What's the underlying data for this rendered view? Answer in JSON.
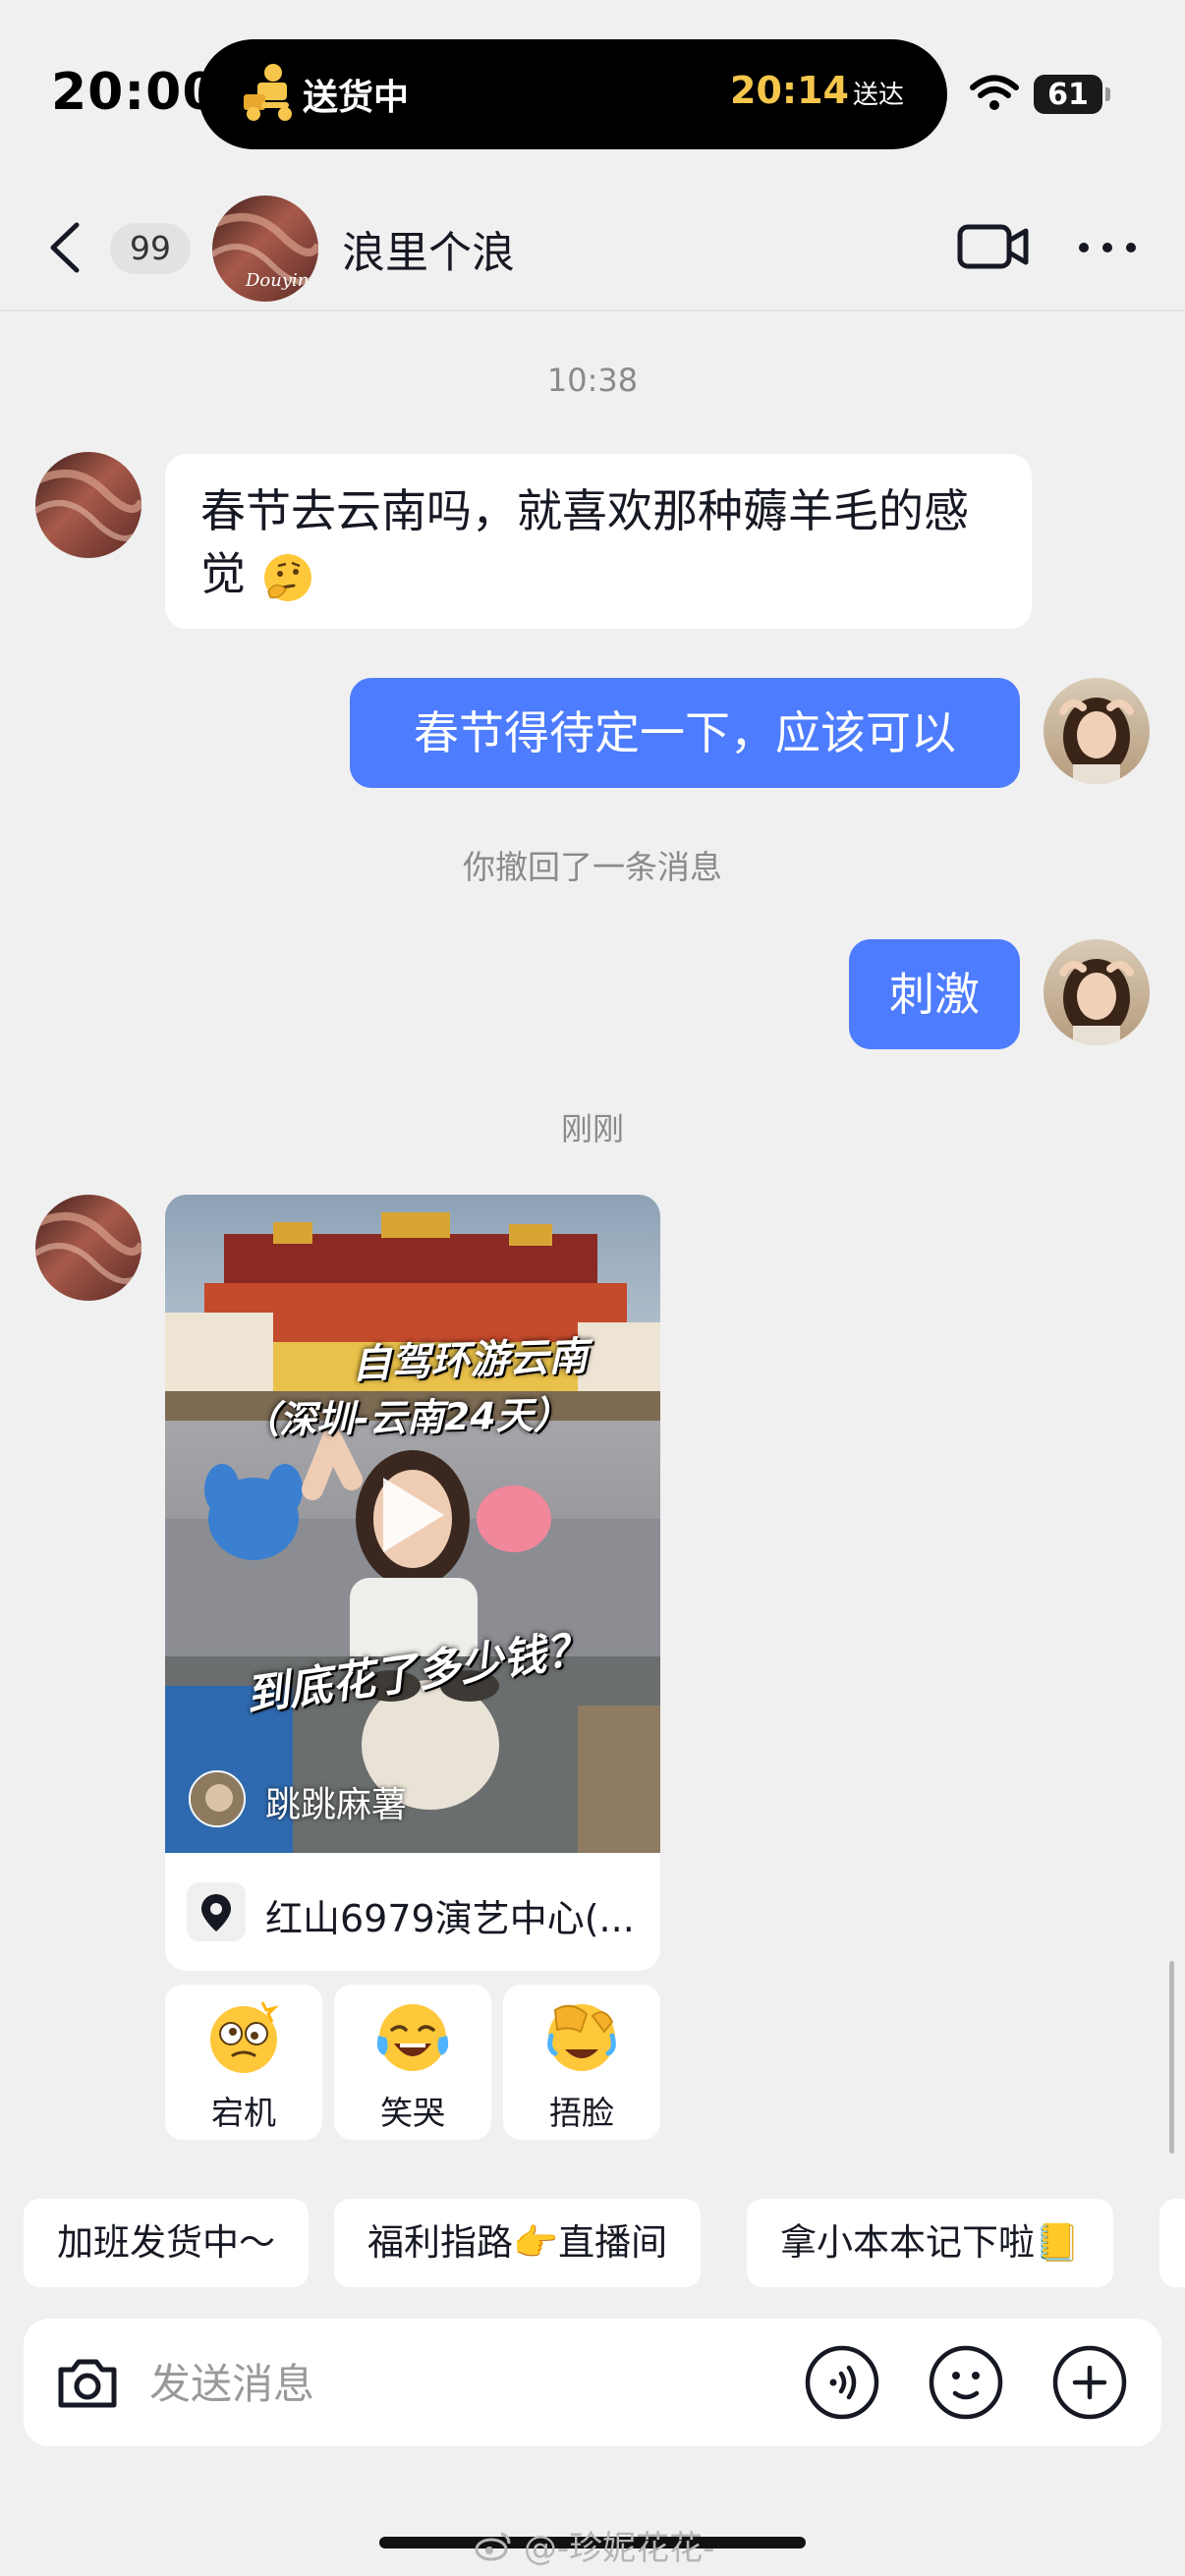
{
  "status_bar": {
    "time": "20:00",
    "live_activity": {
      "title": "送货中",
      "eta_time": "20:14",
      "eta_label": "送达"
    },
    "battery": "61"
  },
  "header": {
    "unread_count": "99",
    "contact_name": "浪里个浪",
    "avatar_text": "Douyin"
  },
  "messages": {
    "timestamp_1": "10:38",
    "incoming_1": "春节去云南吗，就喜欢那种薅羊毛的感觉",
    "outgoing_1": "春节得待定一下，应该可以",
    "recall_notice": "你撤回了一条消息",
    "outgoing_2": "刺激",
    "timestamp_2": "刚刚"
  },
  "shared_video": {
    "caption_1": "自驾环游云南",
    "caption_2": "（深圳-云南24天）",
    "caption_3": "到底花了多少钱？",
    "author": "跳跳麻薯",
    "location": "红山6979演艺中心(..."
  },
  "reactions": [
    {
      "label": "宕机",
      "icon": "dizzy-face-icon"
    },
    {
      "label": "笑哭",
      "icon": "tears-of-joy-icon"
    },
    {
      "label": "捂脸",
      "icon": "facepalm-icon"
    }
  ],
  "suggested_replies": [
    "加班发货中～",
    "福利指路👉直播间",
    "拿小本本记下啦📒"
  ],
  "input": {
    "placeholder": "发送消息"
  },
  "watermark": "@-珍妮花花-",
  "colors": {
    "outgoing_bubble": "#4d7cfe",
    "background": "#f0f0f0",
    "eta": "#f5c64b"
  }
}
